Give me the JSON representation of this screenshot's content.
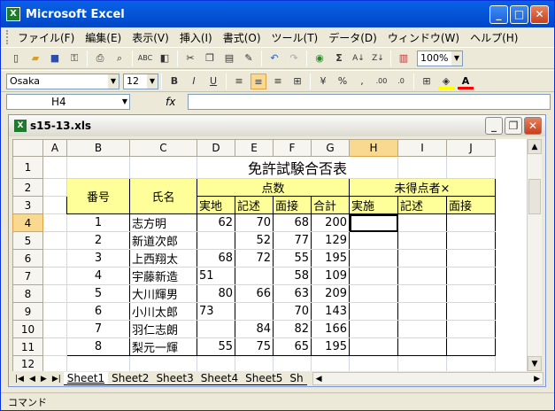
{
  "app": {
    "title": "Microsoft Excel"
  },
  "menu": [
    "ファイル(F)",
    "編集(E)",
    "表示(V)",
    "挿入(I)",
    "書式(O)",
    "ツール(T)",
    "データ(D)",
    "ウィンドウ(W)",
    "ヘルプ(H)"
  ],
  "toolbar": {
    "zoom": "100%",
    "font": "Osaka",
    "size": "12"
  },
  "formula": {
    "namebox": "H4",
    "fx": "fx",
    "content": ""
  },
  "workbook": {
    "title": "s15-13.xls"
  },
  "columns": [
    "",
    "A",
    "B",
    "C",
    "D",
    "E",
    "F",
    "G",
    "H",
    "I",
    "J"
  ],
  "sheet": {
    "title": "免許試験合否表",
    "h_bango": "番号",
    "h_shimei": "氏名",
    "h_tensu": "点数",
    "h_mitoku": "未得点者×",
    "h_jitsuchi": "実地",
    "h_kijutsu": "記述",
    "h_mensetsu": "面接",
    "h_gokei": "合計",
    "h_jisshi": "実施",
    "h_kijutsu2": "記述",
    "h_mensetsu2": "面接",
    "rows": [
      {
        "no": "1",
        "name": "志方明",
        "d": "62",
        "e": "70",
        "f": "68",
        "g": "200"
      },
      {
        "no": "2",
        "name": "新道次郎",
        "d": "",
        "e": "52",
        "f": "77",
        "g": "129"
      },
      {
        "no": "3",
        "name": "上西翔太",
        "d": "68",
        "e": "72",
        "f": "55",
        "g": "195"
      },
      {
        "no": "4",
        "name": "宇藤新造",
        "d": "51",
        "e": "",
        "f": "58",
        "g": "109"
      },
      {
        "no": "5",
        "name": "大川輝男",
        "d": "80",
        "e": "66",
        "f": "63",
        "g": "209"
      },
      {
        "no": "6",
        "name": "小川太郎",
        "d": "73",
        "e": "",
        "f": "70",
        "g": "143"
      },
      {
        "no": "7",
        "name": "羽仁志朗",
        "d": "",
        "e": "84",
        "f": "82",
        "g": "166"
      },
      {
        "no": "8",
        "name": "梨元一輝",
        "d": "55",
        "e": "75",
        "f": "65",
        "g": "195"
      }
    ]
  },
  "tabs": [
    "Sheet1",
    "Sheet2",
    "Sheet3",
    "Sheet4",
    "Sheet5",
    "Sh"
  ],
  "status": "コマンド"
}
